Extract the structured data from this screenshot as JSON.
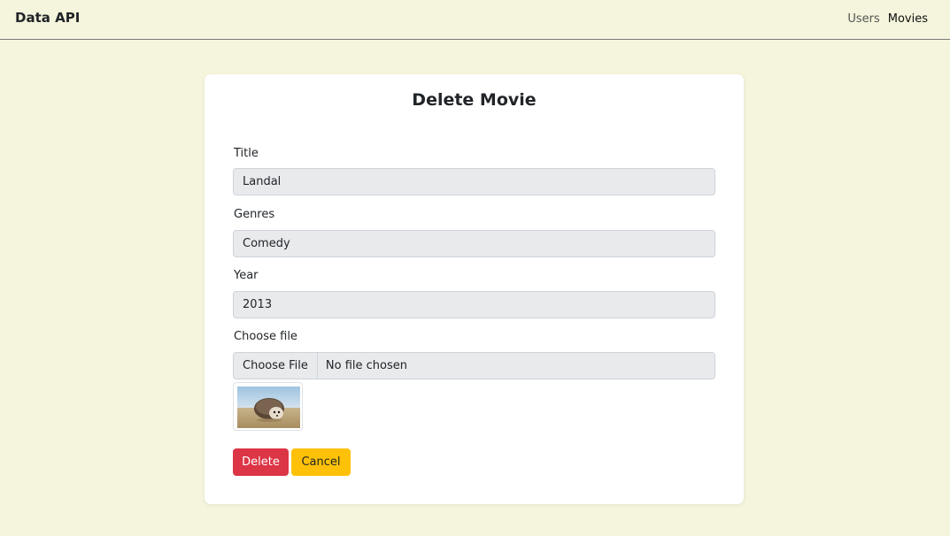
{
  "navbar": {
    "brand": "Data API",
    "links": [
      {
        "label": "Users"
      },
      {
        "label": "Movies"
      }
    ]
  },
  "form": {
    "title": "Delete Movie",
    "fields": {
      "title": {
        "label": "Title",
        "value": "Landal"
      },
      "genres": {
        "label": "Genres",
        "value": "Comedy"
      },
      "year": {
        "label": "Year",
        "value": "2013"
      },
      "file": {
        "label": "Choose file",
        "button_label": "Choose File",
        "status": "No file chosen"
      }
    },
    "thumbnail": {
      "icon": "hedgehog-image"
    },
    "buttons": {
      "delete_label": "Delete",
      "cancel_label": "Cancel"
    }
  },
  "colors": {
    "background": "#f5f4dc",
    "delete": "#dc3545",
    "cancel": "#ffc107"
  }
}
